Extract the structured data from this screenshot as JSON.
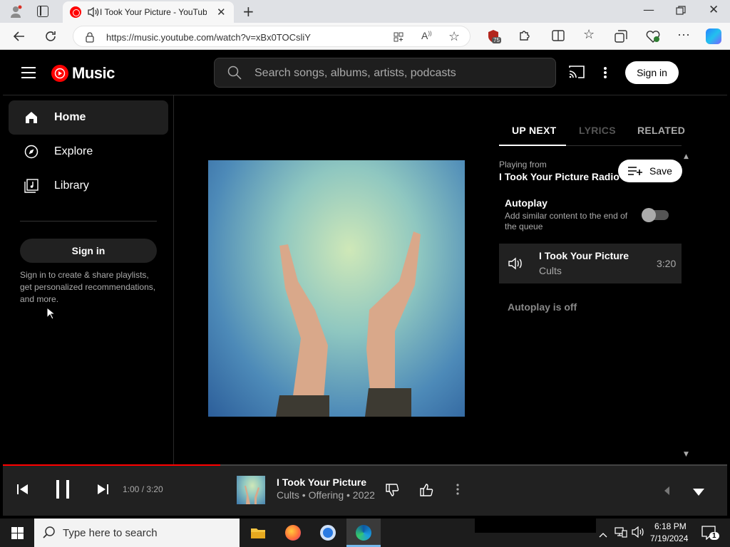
{
  "browser": {
    "tab_title": "I Took Your Picture - YouTube",
    "url": "https://music.youtube.com/watch?v=xBx0TOCsliY",
    "extension_badge": "75"
  },
  "app": {
    "logo_text": "Music",
    "search_placeholder": "Search songs, albums, artists, podcasts",
    "header_signin": "Sign in"
  },
  "sidebar": {
    "items": [
      {
        "label": "Home",
        "icon": "home-icon"
      },
      {
        "label": "Explore",
        "icon": "compass-icon"
      },
      {
        "label": "Library",
        "icon": "library-icon"
      }
    ],
    "signin_button": "Sign in",
    "signin_text": "Sign in to create & share playlists, get personalized recommendations, and more."
  },
  "queue": {
    "tabs": [
      "UP NEXT",
      "LYRICS",
      "RELATED"
    ],
    "playing_from_label": "Playing from",
    "playing_from_value": "I Took Your Picture Radio",
    "save_label": "Save",
    "autoplay_title": "Autoplay",
    "autoplay_desc": "Add similar content to the end of the queue",
    "autoplay_enabled": false,
    "current_track": {
      "title": "I Took Your Picture",
      "artist": "Cults",
      "duration": "3:20"
    },
    "autoplay_status": "Autoplay is off"
  },
  "player": {
    "time": "1:00 / 3:20",
    "progress_fraction": 0.3,
    "title": "I Took Your Picture",
    "subtitle": "Cults • Offering • 2022"
  },
  "taskbar": {
    "search_placeholder": "Type here to search",
    "time": "6:18 PM",
    "date": "7/19/2024",
    "notification_count": "1"
  },
  "colors": {
    "accent": "#ff0000",
    "background": "#000000",
    "panel": "#212121"
  }
}
